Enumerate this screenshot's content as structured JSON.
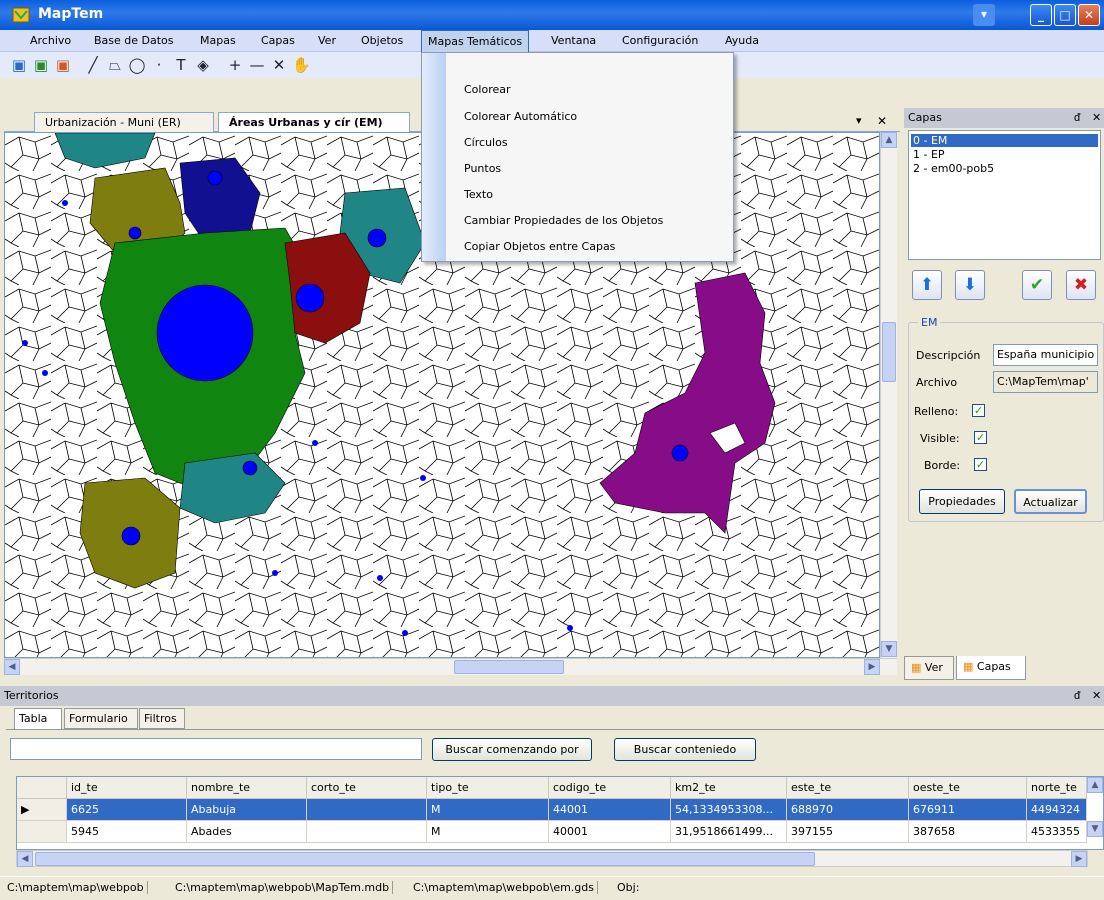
{
  "window": {
    "title": "MapTem",
    "minimize": "_",
    "maximize": "□",
    "close": "✕"
  },
  "menubar": [
    "Archivo",
    "Base de Datos",
    "Mapas",
    "Capas",
    "Ver",
    "Objetos",
    "Mapas Temáticos",
    "Ventana",
    "Configuración",
    "Ayuda"
  ],
  "dropdown": [
    "Colorear",
    "Colorear Automático",
    "Círculos",
    "Puntos",
    "Texto",
    "Cambiar Propiedades de los Objetos",
    "Copiar Objetos entre Capas"
  ],
  "map_tabs": [
    "Urbanización - Muni (ER)",
    "Áreas Urbanas y cír (EM)"
  ],
  "map_tab_controls": {
    "pin": "▾",
    "close": "✕"
  },
  "capas_panel": {
    "title": "Capas",
    "pin": "ᵭ",
    "close": "✕",
    "layers": [
      "0 - EM",
      "1 - EP",
      "2 - em00-pob5"
    ],
    "group_title": "EM",
    "descripcion_label": "Descripción",
    "descripcion_value": "España municipio",
    "archivo_label": "Archivo",
    "archivo_value": "C:\\MapTem\\map'",
    "relleno_label": "Relleno:",
    "visible_label": "Visible:",
    "borde_label": "Borde:",
    "propiedades_btn": "Propiedades",
    "actualizar_btn": "Actualizar",
    "tab_ver": "Ver",
    "tab_capas": "Capas"
  },
  "territorios": {
    "title": "Territorios",
    "tabs": [
      "Tabla",
      "Formulario",
      "Filtros"
    ],
    "search_value": "",
    "btn_starts": "Buscar comenzando por",
    "btn_contains": "Buscar conteniedo",
    "columns": [
      "id_te",
      "nombre_te",
      "corto_te",
      "tipo_te",
      "codigo_te",
      "km2_te",
      "este_te",
      "oeste_te",
      "norte_te"
    ],
    "rows": [
      [
        "6625",
        "Ababuja",
        "",
        "M",
        "44001",
        "54,1334953308...",
        "688970",
        "676911",
        "4494324"
      ],
      [
        "5945",
        "Abades",
        "",
        "M",
        "40001",
        "31,9518661499...",
        "397155",
        "387658",
        "4533355"
      ]
    ]
  },
  "statusbar": [
    "C:\\maptem\\map\\webpob",
    "C:\\maptem\\map\\webpob\\MapTem.mdb",
    "C:\\maptem\\map\\webpob\\em.gds",
    "Obj:"
  ],
  "colors": {
    "blue": "#0000ff",
    "green": "#108510",
    "olive": "#7d7d10",
    "navy": "#101090",
    "teal": "#1f8585",
    "maroon": "#8b0f0f",
    "purple": "#870c87"
  }
}
